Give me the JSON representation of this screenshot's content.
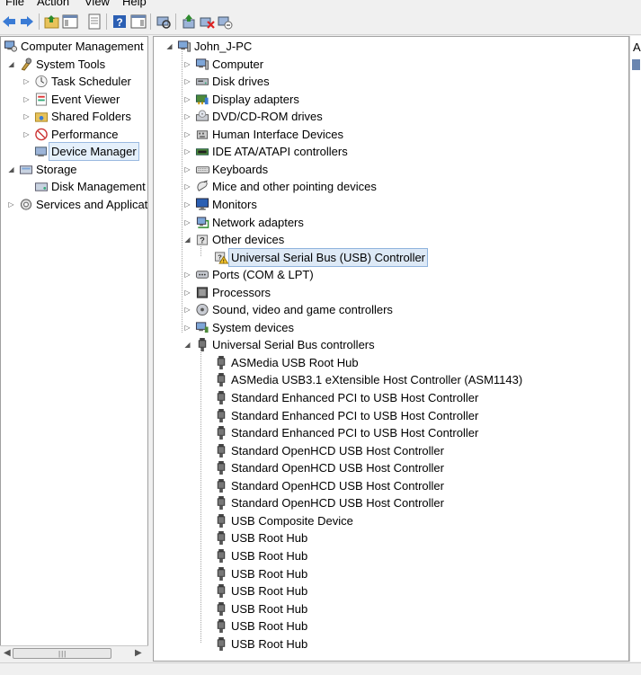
{
  "menu": [
    "File",
    "Action",
    "View",
    "Help"
  ],
  "toolbar": {
    "buttons": [
      "back-arrow-icon",
      "forward-arrow-icon",
      "up-folder-icon",
      "show-hide-console-tree-icon",
      "properties-icon",
      "help-icon",
      "show-action-pane-icon",
      "scan-hardware-icon",
      "update-driver-icon",
      "uninstall-icon",
      "disable-device-icon"
    ]
  },
  "left_tree": [
    {
      "label": "Computer Management",
      "icon": "computer-management-icon",
      "level": 0,
      "expander": ""
    },
    {
      "label": "System Tools",
      "icon": "system-tools-icon",
      "level": 1,
      "expander": "down"
    },
    {
      "label": "Task Scheduler",
      "icon": "task-scheduler-icon",
      "level": 2,
      "expander": "right"
    },
    {
      "label": "Event Viewer",
      "icon": "event-viewer-icon",
      "level": 2,
      "expander": "right"
    },
    {
      "label": "Shared Folders",
      "icon": "shared-folders-icon",
      "level": 2,
      "expander": "right"
    },
    {
      "label": "Performance",
      "icon": "performance-icon",
      "level": 2,
      "expander": "right"
    },
    {
      "label": "Device Manager",
      "icon": "device-manager-icon",
      "level": 2,
      "expander": "",
      "selected": true
    },
    {
      "label": "Storage",
      "icon": "storage-icon",
      "level": 1,
      "expander": "down"
    },
    {
      "label": "Disk Management",
      "icon": "disk-management-icon",
      "level": 2,
      "expander": ""
    },
    {
      "label": "Services and Applications",
      "icon": "services-icon",
      "level": 1,
      "expander": "right"
    }
  ],
  "device_tree": {
    "root": {
      "label": "John_J-PC",
      "icon": "computer-icon"
    },
    "categories": [
      {
        "label": "Computer",
        "icon": "computer-icon",
        "expander": "right"
      },
      {
        "label": "Disk drives",
        "icon": "disk-drive-icon",
        "expander": "right"
      },
      {
        "label": "Display adapters",
        "icon": "display-adapter-icon",
        "expander": "right"
      },
      {
        "label": "DVD/CD-ROM drives",
        "icon": "dvd-drive-icon",
        "expander": "right"
      },
      {
        "label": "Human Interface Devices",
        "icon": "hid-icon",
        "expander": "right"
      },
      {
        "label": "IDE ATA/ATAPI controllers",
        "icon": "ide-controller-icon",
        "expander": "right"
      },
      {
        "label": "Keyboards",
        "icon": "keyboard-icon",
        "expander": "right"
      },
      {
        "label": "Mice and other pointing devices",
        "icon": "mouse-icon",
        "expander": "right"
      },
      {
        "label": "Monitors",
        "icon": "monitor-icon",
        "expander": "right"
      },
      {
        "label": "Network adapters",
        "icon": "network-adapter-icon",
        "expander": "right"
      },
      {
        "label": "Other devices",
        "icon": "unknown-device-icon",
        "expander": "down",
        "children": [
          {
            "label": "Universal Serial Bus (USB) Controller",
            "icon": "warning-device-icon",
            "selected": true
          }
        ]
      },
      {
        "label": "Ports (COM & LPT)",
        "icon": "port-icon",
        "expander": "right"
      },
      {
        "label": "Processors",
        "icon": "processor-icon",
        "expander": "right"
      },
      {
        "label": "Sound, video and game controllers",
        "icon": "sound-icon",
        "expander": "right"
      },
      {
        "label": "System devices",
        "icon": "system-device-icon",
        "expander": "right"
      },
      {
        "label": "Universal Serial Bus controllers",
        "icon": "usb-icon",
        "expander": "down",
        "children": [
          {
            "label": "ASMedia USB Root Hub",
            "icon": "usb-icon"
          },
          {
            "label": "ASMedia USB3.1 eXtensible Host Controller (ASM1143)",
            "icon": "usb-icon"
          },
          {
            "label": "Standard Enhanced PCI to USB Host Controller",
            "icon": "usb-icon"
          },
          {
            "label": "Standard Enhanced PCI to USB Host Controller",
            "icon": "usb-icon"
          },
          {
            "label": "Standard Enhanced PCI to USB Host Controller",
            "icon": "usb-icon"
          },
          {
            "label": "Standard OpenHCD USB Host Controller",
            "icon": "usb-icon"
          },
          {
            "label": "Standard OpenHCD USB Host Controller",
            "icon": "usb-icon"
          },
          {
            "label": "Standard OpenHCD USB Host Controller",
            "icon": "usb-icon"
          },
          {
            "label": "Standard OpenHCD USB Host Controller",
            "icon": "usb-icon"
          },
          {
            "label": "USB Composite Device",
            "icon": "usb-icon"
          },
          {
            "label": "USB Root Hub",
            "icon": "usb-icon"
          },
          {
            "label": "USB Root Hub",
            "icon": "usb-icon"
          },
          {
            "label": "USB Root Hub",
            "icon": "usb-icon"
          },
          {
            "label": "USB Root Hub",
            "icon": "usb-icon"
          },
          {
            "label": "USB Root Hub",
            "icon": "usb-icon"
          },
          {
            "label": "USB Root Hub",
            "icon": "usb-icon"
          },
          {
            "label": "USB Root Hub",
            "icon": "usb-icon"
          }
        ]
      }
    ]
  },
  "actions_pane": {
    "label": "A"
  },
  "colors": {
    "selection": "#dde9f6",
    "selection_border": "#8fb3dd",
    "window_bg": "#f0f0f0",
    "pane_border": "#a0a0a0"
  }
}
